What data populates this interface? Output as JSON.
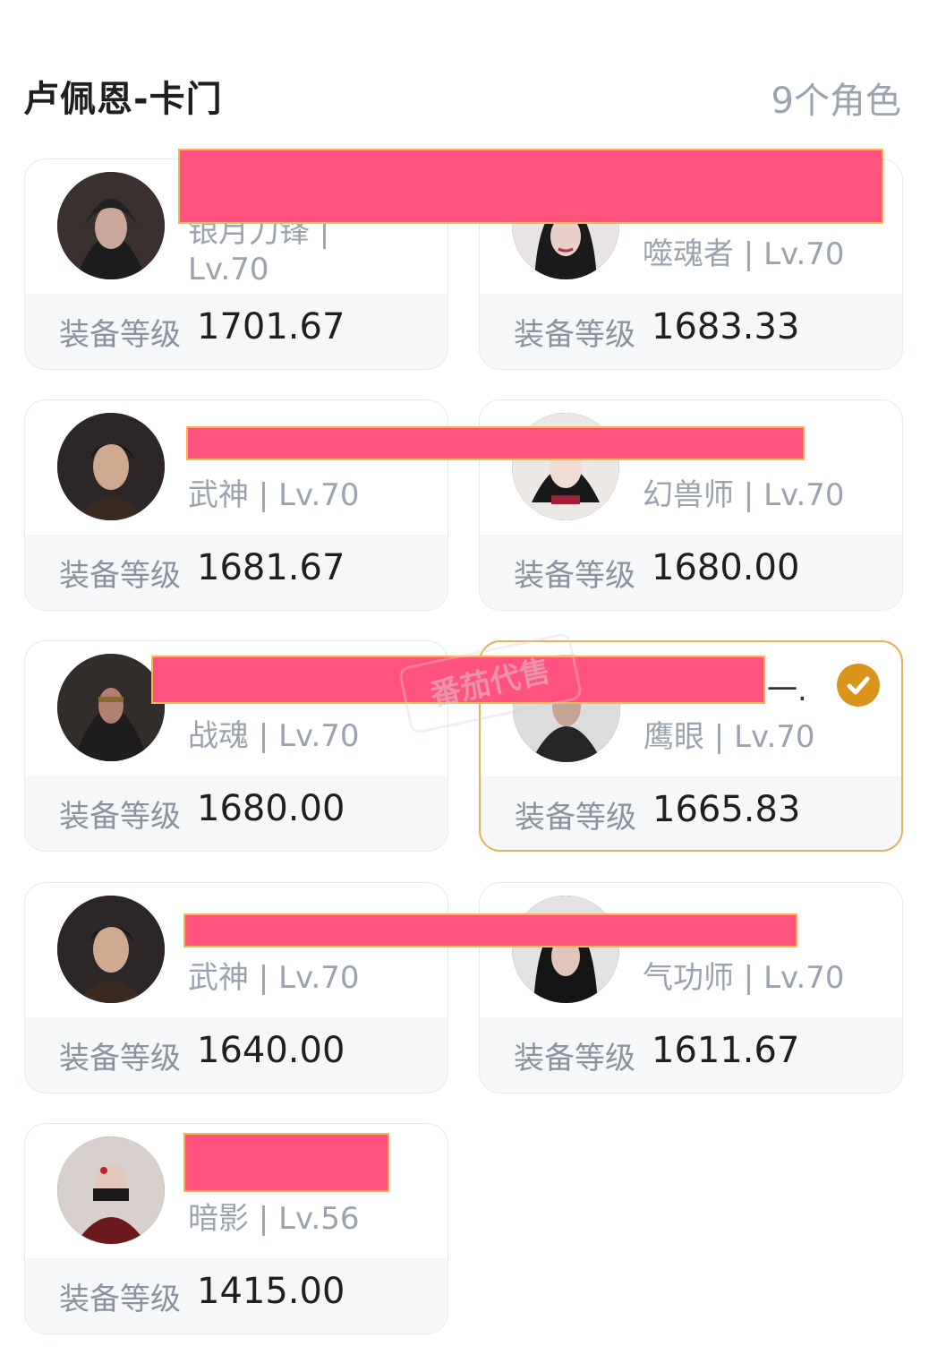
{
  "header": {
    "server_title": "卢佩恩-卡门",
    "role_count": "9个角色"
  },
  "gear_label": "装备等级",
  "watermark_text": "番茄代售",
  "characters": [
    {
      "name": "",
      "class_level": "银月刀锋 | Lv.70",
      "gear": "1701.67",
      "selected": false
    },
    {
      "name": "",
      "class_level": "噬魂者 | Lv.70",
      "gear": "1683.33",
      "selected": false
    },
    {
      "name": "",
      "class_level": "武神 | Lv.70",
      "gear": "1681.67",
      "selected": false
    },
    {
      "name": "",
      "class_level": "幻兽师 | Lv.70",
      "gear": "1680.00",
      "selected": false
    },
    {
      "name": "",
      "class_level": "战魂 | Lv.70",
      "gear": "1680.00",
      "selected": false
    },
    {
      "name": "一.",
      "class_level": "鹰眼 | Lv.70",
      "gear": "1665.83",
      "selected": true
    },
    {
      "name": "",
      "class_level": "武神 | Lv.70",
      "gear": "1640.00",
      "selected": false
    },
    {
      "name": "",
      "class_level": "气功师 | Lv.70",
      "gear": "1611.67",
      "selected": false
    },
    {
      "name": "",
      "class_level": "暗影 | Lv.56",
      "gear": "1415.00",
      "selected": false
    }
  ],
  "colors": {
    "accent_selected": "#d9941a",
    "redaction": "#ff527e"
  }
}
